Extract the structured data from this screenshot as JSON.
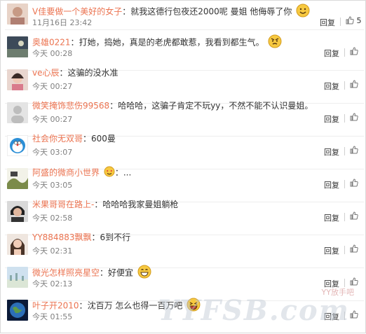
{
  "comments": [
    {
      "user": "V佳要做一个美好的女子",
      "text": "就我这德行包夜还2000呢 曼姐 他侮辱了你",
      "time": "11月16日 23:42",
      "reply": "回复",
      "likes": "5",
      "emoji": "smile"
    },
    {
      "user": "奥雄0221",
      "text": "打她，捣她，真是的老虎都敢惹，我看到都生气。",
      "time": "今天 00:28",
      "reply": "回复",
      "likes": "",
      "emoji": "angry"
    },
    {
      "user": "ve心辰",
      "text": "这骗的没水准",
      "time": "今天 00:27",
      "reply": "回复",
      "likes": "",
      "emoji": ""
    },
    {
      "user": "微笑掩饰悲伤99568",
      "text": "哈哈哈，这骗子肯定不玩yy，不然不能不认识曼姐。",
      "time": "今天 00:27",
      "reply": "回复",
      "likes": "",
      "emoji": ""
    },
    {
      "user": "社会你无双哥",
      "text": "600曼",
      "time": "今天 03:07",
      "reply": "回复",
      "likes": "",
      "emoji": ""
    },
    {
      "user": "阿盛的微商小世界",
      "text": "...",
      "time": "今天 03:05",
      "reply": "回复",
      "likes": "",
      "emoji": "love"
    },
    {
      "user": "米果哥哥在路上-",
      "text": "哈哈哈我家曼姐躺枪",
      "time": "今天 02:58",
      "reply": "回复",
      "likes": "",
      "emoji": ""
    },
    {
      "user": "YY884883飘飘",
      "text": "6到不行",
      "time": "今天 02:31",
      "reply": "回复",
      "likes": "",
      "emoji": ""
    },
    {
      "user": "微光怎样照亮星空",
      "text": "好便宜",
      "time": "今天 02:13",
      "reply": "回复",
      "likes": "",
      "emoji": "grin"
    },
    {
      "user": "叶子开2010",
      "text": "沈百万 怎么也得一百万吧",
      "time": "今天 01:55",
      "reply": "回复",
      "likes": "",
      "emoji": "laugh"
    }
  ],
  "watermark": "YYFSB.com",
  "watermark_sub": "YY放手吧"
}
